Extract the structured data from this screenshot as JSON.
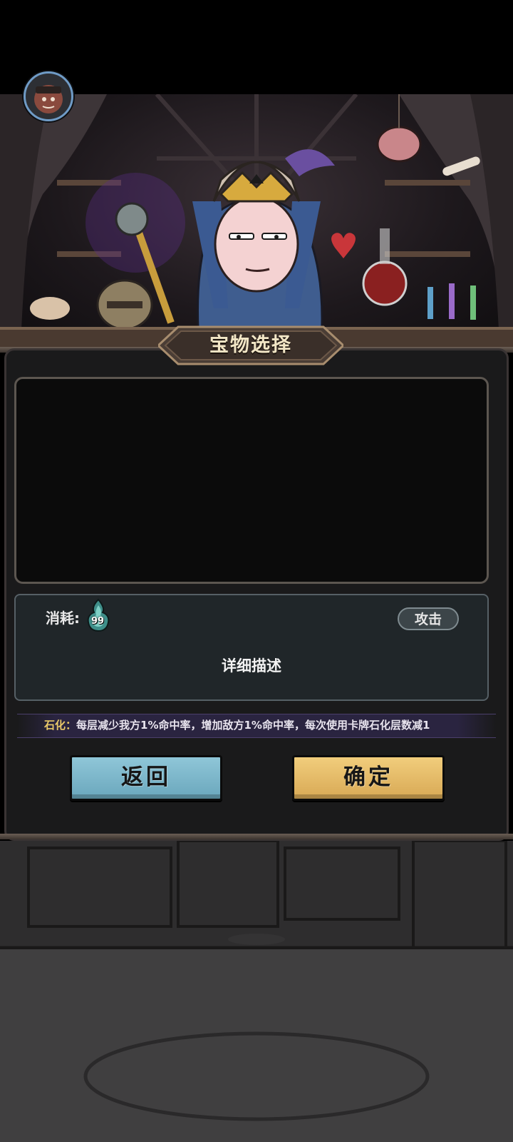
{
  "panel": {
    "title": "宝物选择"
  },
  "cost": {
    "label": "消耗:",
    "count": "99",
    "icon": "soul-flame-icon"
  },
  "treasure": {
    "type_badge": "攻击",
    "description": "详细描述"
  },
  "effect": {
    "keyword": "石化",
    "separator": "：",
    "text": "每层减少我方1%命中率，增加敌方1%命中率，每次使用卡牌石化层数减1"
  },
  "buttons": {
    "back_label": "返回",
    "confirm_label": "确定"
  },
  "colors": {
    "back_button": "#7fb9cc",
    "confirm_button": "#e4bb68",
    "effect_keyword": "#e9c868"
  }
}
